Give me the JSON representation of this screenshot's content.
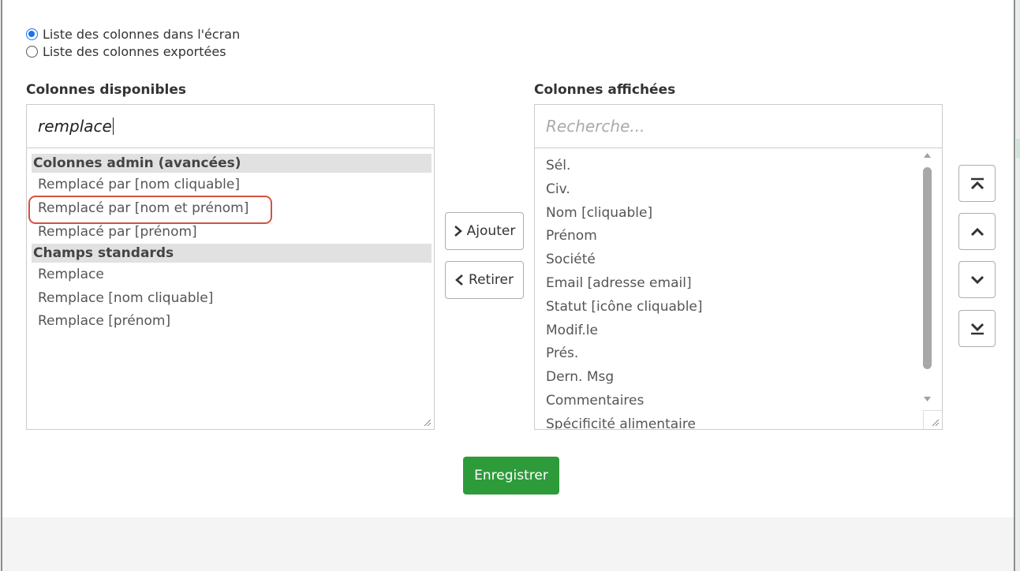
{
  "view_mode": {
    "options": [
      {
        "label": "Liste des colonnes dans l'écran",
        "checked": true
      },
      {
        "label": "Liste des colonnes exportées",
        "checked": false
      }
    ]
  },
  "available": {
    "title": "Colonnes disponibles",
    "search_value": "remplace",
    "groups": [
      {
        "header": "Colonnes admin (avancées)",
        "items": [
          "Remplacé par [nom cliquable]",
          "Remplacé par [nom et prénom]",
          "Remplacé par [prénom]"
        ]
      },
      {
        "header": "Champs standards",
        "items": [
          "Remplace",
          "Remplace [nom cliquable]",
          "Remplace [prénom]"
        ]
      }
    ]
  },
  "actions": {
    "add_label": "Ajouter",
    "remove_label": "Retirer",
    "save_label": "Enregistrer"
  },
  "displayed": {
    "title": "Colonnes affichées",
    "search_placeholder": "Recherche...",
    "items": [
      "Sél.",
      "Civ.",
      "Nom [cliquable]",
      "Prénom",
      "Société",
      "Email [adresse email]",
      "Statut [icône cliquable]",
      "Modif.le",
      "Prés.",
      "Dern. Msg",
      "Commentaires",
      "Spécificité alimentaire"
    ]
  },
  "order_buttons": [
    "move-top-icon",
    "move-up-icon",
    "move-down-icon",
    "move-bottom-icon"
  ],
  "colors": {
    "accent": "#1a73e8",
    "save_green": "#2e9b3a",
    "highlight_red": "#d4523f",
    "group_header_bg": "#e1e1e1"
  }
}
